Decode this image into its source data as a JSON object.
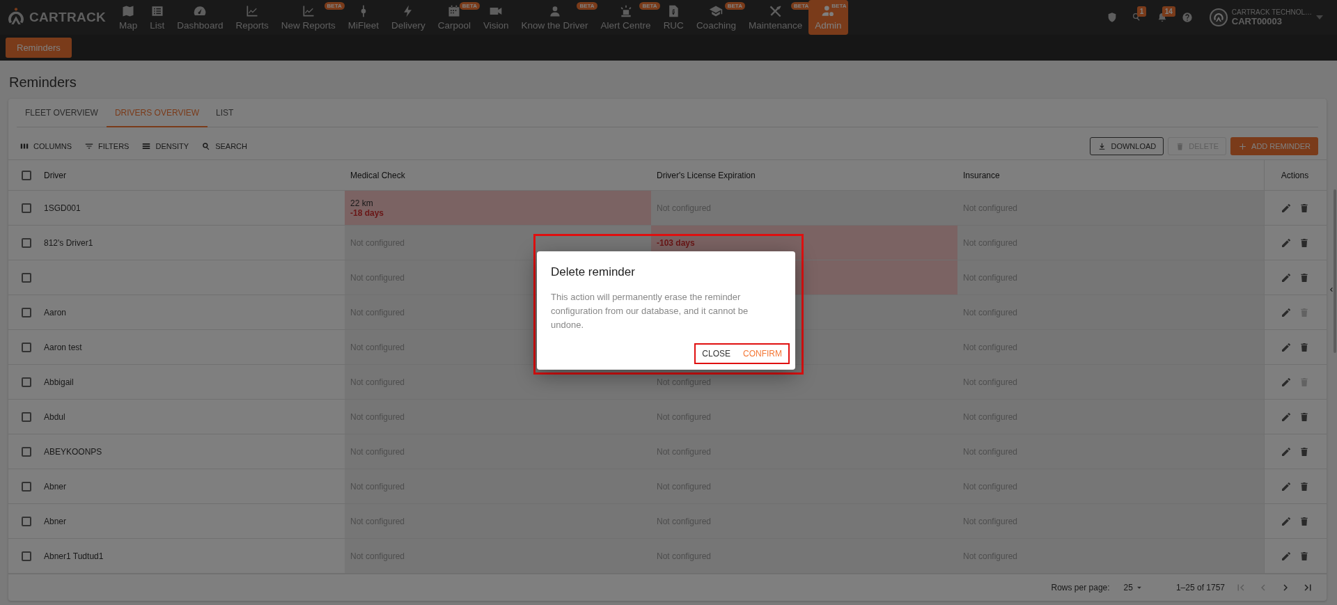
{
  "nav": {
    "brand": "CARTRACK",
    "items": [
      {
        "label": "Map",
        "selected": false
      },
      {
        "label": "List",
        "selected": false
      },
      {
        "label": "Dashboard",
        "selected": false
      },
      {
        "label": "Reports",
        "selected": false
      },
      {
        "label": "New Reports",
        "beta": "BETA",
        "selected": false
      },
      {
        "label": "MiFleet",
        "selected": false
      },
      {
        "label": "Delivery",
        "selected": false
      },
      {
        "label": "Carpool",
        "beta": "BETA",
        "selected": false
      },
      {
        "label": "Vision",
        "selected": false
      },
      {
        "label": "Know the Driver",
        "beta": "BETA",
        "selected": false
      },
      {
        "label": "Alert Centre",
        "beta": "BETA",
        "selected": false
      },
      {
        "label": "RUC",
        "selected": false
      },
      {
        "label": "Coaching",
        "beta": "BETA",
        "selected": false
      },
      {
        "label": "Maintenance",
        "beta": "BETA",
        "selected": false
      },
      {
        "label": "Admin",
        "beta": "BETA",
        "selected": true
      }
    ]
  },
  "header": {
    "search_badge": "1",
    "alert_badge": "14",
    "company": "CARTRACK TECHNOL…",
    "account": "CART00003"
  },
  "subnav": {
    "items": [
      {
        "label": "Reminders",
        "selected": true
      }
    ]
  },
  "page": {
    "title": "Reminders"
  },
  "tabs": [
    {
      "label": "FLEET OVERVIEW",
      "selected": false
    },
    {
      "label": "DRIVERS OVERVIEW",
      "selected": true
    },
    {
      "label": "LIST",
      "selected": false
    }
  ],
  "toolbar": {
    "left": [
      {
        "label": "COLUMNS"
      },
      {
        "label": "FILTERS"
      },
      {
        "label": "DENSITY"
      },
      {
        "label": "SEARCH"
      }
    ],
    "right": [
      {
        "label": "DOWNLOAD",
        "kind": "outlined",
        "disabled": false
      },
      {
        "label": "DELETE",
        "kind": "text",
        "disabled": true
      },
      {
        "label": "ADD REMINDER",
        "kind": "filled",
        "disabled": false
      }
    ]
  },
  "table": {
    "header_checked": false,
    "columns": [
      "Driver",
      "Medical Check",
      "Driver's License Expiration",
      "Insurance",
      "Actions"
    ],
    "rows": [
      {
        "checked": false,
        "cells": [
          {
            "text": "1SGD001"
          },
          {
            "overdue": true,
            "lines": [
              {
                "text": "22 km",
                "overdue": false
              },
              {
                "text": "-18 days",
                "overdue": true
              }
            ]
          },
          {
            "overdue": false,
            "lines": [
              {
                "text": "Not configured",
                "overdue": false
              }
            ]
          },
          {
            "overdue": false,
            "lines": [
              {
                "text": "Not configured",
                "overdue": false
              }
            ]
          }
        ],
        "delete_disabled": false
      },
      {
        "checked": false,
        "cells": [
          {
            "text": "812's Driver1"
          },
          {
            "overdue": false,
            "lines": [
              {
                "text": "Not configured",
                "overdue": false
              }
            ]
          },
          {
            "overdue": true,
            "lines": [
              {
                "text": "-103 days",
                "overdue": true
              }
            ]
          },
          {
            "overdue": false,
            "lines": [
              {
                "text": "Not configured",
                "overdue": false
              }
            ]
          }
        ],
        "delete_disabled": false
      },
      {
        "checked": false,
        "cells": [
          {},
          {
            "overdue": false,
            "lines": [
              {
                "text": "Not configured",
                "overdue": false
              }
            ]
          },
          {
            "overdue": true
          },
          {
            "overdue": false,
            "lines": [
              {
                "text": "Not configured",
                "overdue": false
              }
            ]
          }
        ],
        "delete_disabled": false
      },
      {
        "checked": false,
        "cells": [
          {
            "text": "Aaron"
          },
          {
            "overdue": false,
            "lines": [
              {
                "text": "Not configured",
                "overdue": false
              }
            ]
          },
          {
            "overdue": false
          },
          {
            "overdue": false,
            "lines": [
              {
                "text": "Not configured",
                "overdue": false
              }
            ]
          }
        ],
        "delete_disabled": true
      },
      {
        "checked": false,
        "cells": [
          {
            "text": "Aaron test"
          },
          {
            "overdue": false,
            "lines": [
              {
                "text": "Not configured",
                "overdue": false
              }
            ]
          },
          {
            "overdue": false
          },
          {
            "overdue": false,
            "lines": [
              {
                "text": "Not configured",
                "overdue": false
              }
            ]
          }
        ],
        "delete_disabled": false
      },
      {
        "checked": false,
        "cells": [
          {
            "text": "Abbigail"
          },
          {
            "overdue": false,
            "lines": [
              {
                "text": "Not configured",
                "overdue": false
              }
            ]
          },
          {
            "overdue": false,
            "lines": [
              {
                "text": "Not configured",
                "overdue": false
              }
            ]
          },
          {
            "overdue": false,
            "lines": [
              {
                "text": "Not configured",
                "overdue": false
              }
            ]
          }
        ],
        "delete_disabled": true
      },
      {
        "checked": false,
        "cells": [
          {
            "text": "Abdul"
          },
          {
            "overdue": false,
            "lines": [
              {
                "text": "Not configured",
                "overdue": false
              }
            ]
          },
          {
            "overdue": false,
            "lines": [
              {
                "text": "Not configured",
                "overdue": false
              }
            ]
          },
          {
            "overdue": false,
            "lines": [
              {
                "text": "Not configured",
                "overdue": false
              }
            ]
          }
        ],
        "delete_disabled": false
      },
      {
        "checked": false,
        "cells": [
          {
            "text": "ABEYKOONPS"
          },
          {
            "overdue": false,
            "lines": [
              {
                "text": "Not configured",
                "overdue": false
              }
            ]
          },
          {
            "overdue": false,
            "lines": [
              {
                "text": "Not configured",
                "overdue": false
              }
            ]
          },
          {
            "overdue": false,
            "lines": [
              {
                "text": "Not configured",
                "overdue": false
              }
            ]
          }
        ],
        "delete_disabled": false
      },
      {
        "checked": false,
        "cells": [
          {
            "text": "Abner"
          },
          {
            "overdue": false,
            "lines": [
              {
                "text": "Not configured",
                "overdue": false
              }
            ]
          },
          {
            "overdue": false,
            "lines": [
              {
                "text": "Not configured",
                "overdue": false
              }
            ]
          },
          {
            "overdue": false,
            "lines": [
              {
                "text": "Not configured",
                "overdue": false
              }
            ]
          }
        ],
        "delete_disabled": false
      },
      {
        "checked": false,
        "cells": [
          {
            "text": "Abner"
          },
          {
            "overdue": false,
            "lines": [
              {
                "text": "Not configured",
                "overdue": false
              }
            ]
          },
          {
            "overdue": false,
            "lines": [
              {
                "text": "Not configured",
                "overdue": false
              }
            ]
          },
          {
            "overdue": false,
            "lines": [
              {
                "text": "Not configured",
                "overdue": false
              }
            ]
          }
        ],
        "delete_disabled": false
      },
      {
        "checked": false,
        "cells": [
          {
            "text": "Abner1 Tudtud1"
          },
          {
            "overdue": false,
            "lines": [
              {
                "text": "Not configured",
                "overdue": false
              }
            ]
          },
          {
            "overdue": false,
            "lines": [
              {
                "text": "Not configured",
                "overdue": false
              }
            ]
          },
          {
            "overdue": false,
            "lines": [
              {
                "text": "Not configured",
                "overdue": false
              }
            ]
          }
        ],
        "delete_disabled": false
      }
    ]
  },
  "pagination": {
    "rows_per_page_label": "Rows per page:",
    "rows_per_page": "25",
    "range": "1–25 of 1757",
    "first_disabled": true,
    "prev_disabled": true,
    "next_disabled": false,
    "last_disabled": false
  },
  "dialog": {
    "title": "Delete reminder",
    "body": "This action will permanently erase the reminder configuration from our database, and it cannot be undone.",
    "highlighted": true,
    "buttons_highlighted": true,
    "buttons": [
      {
        "label": "CLOSE",
        "kind": "neutral"
      },
      {
        "label": "CONFIRM",
        "kind": "primary"
      }
    ]
  }
}
